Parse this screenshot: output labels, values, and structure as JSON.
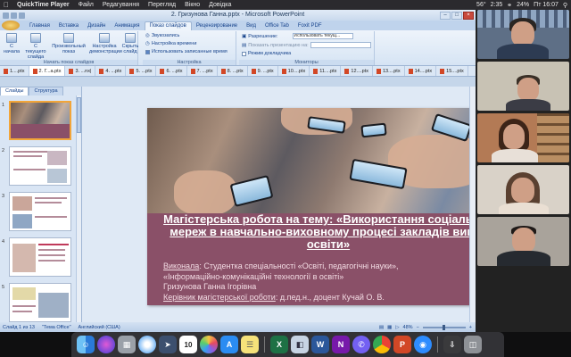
{
  "menubar": {
    "app_name": "QuickTime Player",
    "items": [
      "Файл",
      "Редагування",
      "Перегляд",
      "Вікно",
      "Довідка"
    ],
    "status": {
      "temperature": "56°",
      "volume": "2:35",
      "battery": "24%",
      "clock": "Пт 16:07"
    }
  },
  "ppt": {
    "window_title": "2. Гризунова Ганна.pptx - Microsoft PowerPoint",
    "tabs": [
      "Главная",
      "Вставка",
      "Дизайн",
      "Анимация",
      "Показ слайдов",
      "Рецензирование",
      "Вид",
      "Office Tab",
      "Foxit PDF"
    ],
    "active_tab": "Показ слайдов",
    "ribbon": {
      "group_start_label": "Начать показ слайдов",
      "btn_from_start": "С начала",
      "btn_from_current": "С текущего слайда",
      "btn_custom_show": "Произвольный показ",
      "btn_setup_show": "Настройка демонстрации",
      "btn_hide_slide": "Скрыть слайд",
      "opt_record_narration": "Звукозапись",
      "opt_rehearse_timings": "Настройка времени",
      "opt_use_timings": "Использовать записанные время",
      "group_setup_label": "Настройка",
      "resolution_label": "Разрешение:",
      "resolution_value": "Использовать текущ...",
      "show_on_label": "Показать презентацию на:",
      "presenter_view_label": "Режим докладчика",
      "group_monitors_label": "Мониторы"
    },
    "file_tabs": [
      "1....ptx",
      "2. Г...a.ptx",
      "3. ...nx|",
      "4. ...ptx",
      "5. ...ptx",
      "6. ...ptx",
      "7. ...ptx",
      "8. ...ptx",
      "9. ...ptx",
      "10....ptx",
      "11....ptx",
      "12....ptx",
      "13....ptx",
      "14....ptx",
      "15....ptx"
    ],
    "pane_tabs": [
      "Слайды",
      "Структура"
    ],
    "thumb_numbers": [
      "1",
      "2",
      "3",
      "4",
      "5"
    ],
    "slide": {
      "title": "Магістерська робота на тему: «Використання соціальних мереж в навчально-виховному процесі закладів вищої освіти»",
      "line1_label": "Виконала",
      "line1_text": ": Студентка спеціальності «Освіті, педагогічні науки»,",
      "line2": "«Інформаційно-комунікаційні технології в освіті»",
      "line3": "Гризунова Ганна Ігорівна",
      "line4_label": "Керівник магістерської роботи",
      "line4_text": ": д.пед.н., доцент Кучай О. В."
    },
    "status": {
      "slide_counter": "Слайд 1 из 13",
      "theme": "\"Тема Office\"",
      "language": "Английский (США)",
      "zoom": "48%"
    }
  },
  "dock": {
    "apps": [
      "finder",
      "siri",
      "launchpad",
      "safari",
      "rocket",
      "calendar",
      "photos",
      "app-store",
      "notes",
      "excel",
      "preview",
      "word",
      "onenote",
      "viber",
      "chrome",
      "powerpoint",
      "zoom",
      "trash-icon-area",
      "trash"
    ],
    "calendar_day": "10"
  },
  "colors": {
    "slide_stripe": "#8a5068",
    "ribbon_blue": "#15428b",
    "selected_thumb": "#f2a539"
  }
}
